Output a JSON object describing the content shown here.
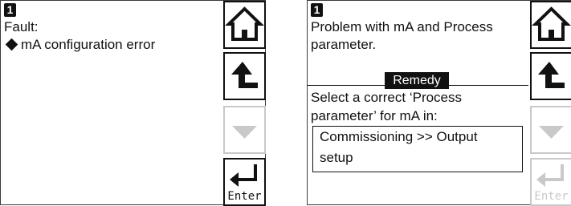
{
  "screen1": {
    "badge": "1",
    "title": "Fault:",
    "message": "mA configuration error"
  },
  "screen2": {
    "badge": "1",
    "problem_lines": [
      "Problem with mA and Process",
      "parameter."
    ],
    "remedy_label": "Remedy",
    "instruction_lines": [
      "Select a correct ‘Process",
      "parameter’  for mA in:"
    ],
    "menu_path_lines": [
      "Commissioning >> Output",
      "setup"
    ]
  },
  "buttons": {
    "home_icon": "home-icon",
    "back_icon": "back-arrow-icon",
    "down_icon": "down-arrow-icon",
    "enter_icon": "enter-arrow-icon",
    "enter_label": "Enter"
  },
  "colors": {
    "active": "#111111",
    "disabled": "#c9c9c9",
    "background": "#ffffff"
  }
}
